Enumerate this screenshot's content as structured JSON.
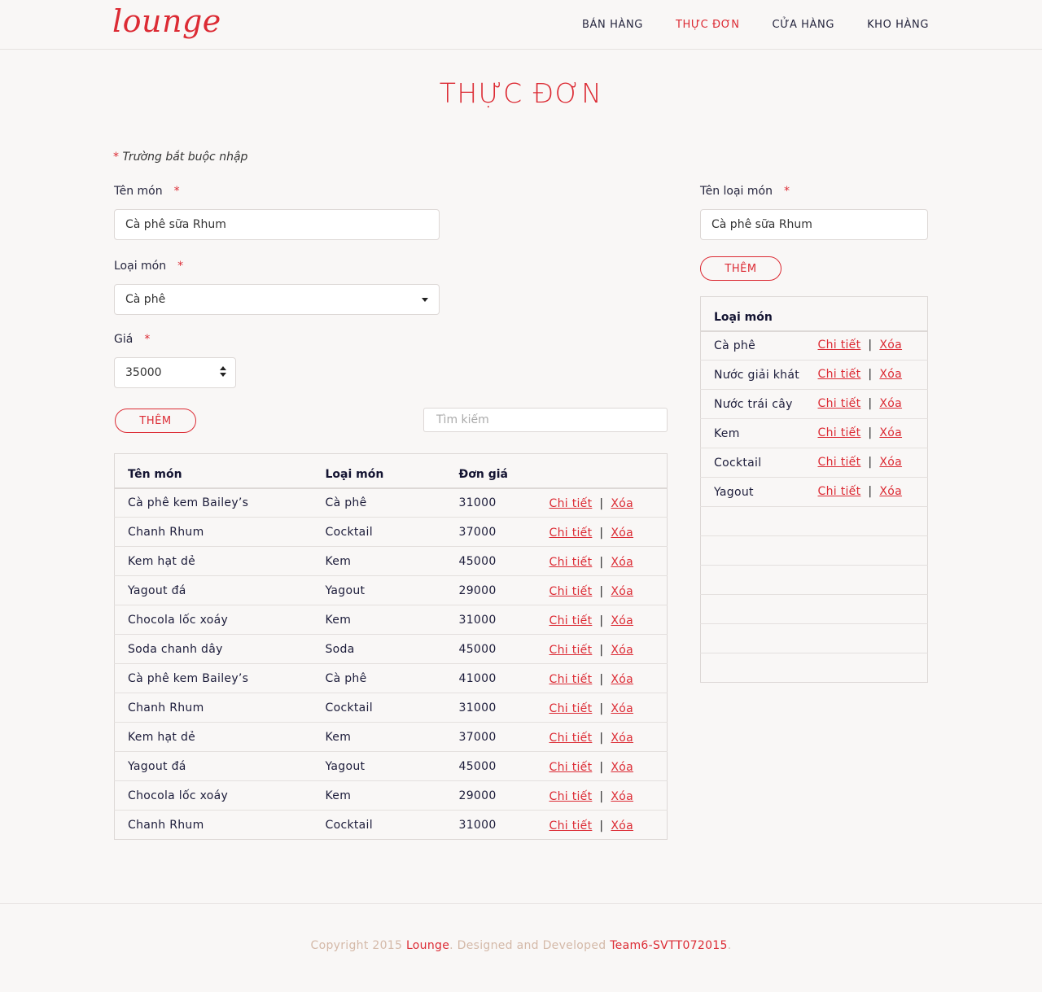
{
  "brand": "lounge",
  "nav": [
    {
      "label": "BÁN HÀNG",
      "active": false
    },
    {
      "label": "THỰC ĐƠN",
      "active": true
    },
    {
      "label": "CỬA HÀNG",
      "active": false
    },
    {
      "label": "KHO HÀNG",
      "active": false
    }
  ],
  "page_title": "THỰC ĐƠN",
  "required_note": "Trường bắt buộc nhập",
  "required_mark": "*",
  "form": {
    "name_label": "Tên món",
    "name_value": "Cà phê sữa Rhum",
    "category_label": "Loại món",
    "category_value": "Cà phê",
    "price_label": "Giá",
    "price_value": "35000",
    "add_button": "THÊM",
    "search_placeholder": "Tìm kiếm"
  },
  "category_form": {
    "name_label": "Tên loại món",
    "name_value": "Cà phê sữa Rhum",
    "add_button": "THÊM"
  },
  "menu_table": {
    "headers": [
      "Tên món",
      "Loại món",
      "Đơn giá"
    ],
    "detail_label": "Chi tiết",
    "delete_label": "Xóa",
    "separator": "|",
    "rows": [
      [
        "Cà phê kem Bailey’s",
        "Cà phê",
        "31000"
      ],
      [
        "Chanh Rhum",
        "Cocktail",
        "37000"
      ],
      [
        "Kem hạt dẻ",
        "Kem",
        "45000"
      ],
      [
        "Yagout đá",
        "Yagout",
        "29000"
      ],
      [
        "Chocola lốc xoáy",
        "Kem",
        "31000"
      ],
      [
        "Soda chanh dây",
        "Soda",
        "45000"
      ],
      [
        "Cà phê kem Bailey’s",
        "Cà phê",
        "41000"
      ],
      [
        "Chanh Rhum",
        "Cocktail",
        "31000"
      ],
      [
        "Kem hạt dẻ",
        "Kem",
        "37000"
      ],
      [
        "Yagout đá",
        "Yagout",
        "45000"
      ],
      [
        "Chocola lốc xoáy",
        "Kem",
        "29000"
      ],
      [
        "Chanh Rhum",
        "Cocktail",
        "31000"
      ]
    ]
  },
  "category_table": {
    "header": "Loại món",
    "rows": [
      "Cà phê",
      "Nước giải khát",
      "Nước trái cây",
      "Kem",
      "Cocktail",
      "Yagout"
    ],
    "empty_rows": 6
  },
  "footer": {
    "prefix": "Copyright 2015 ",
    "brand": "Lounge",
    "middle": ". Designed and Developed ",
    "team": "Team6-SVTT072015",
    "suffix": "."
  },
  "colors": {
    "accent": "#dc2b34",
    "background": "#f9f7f6",
    "footer_text": "#d4b9a8"
  }
}
